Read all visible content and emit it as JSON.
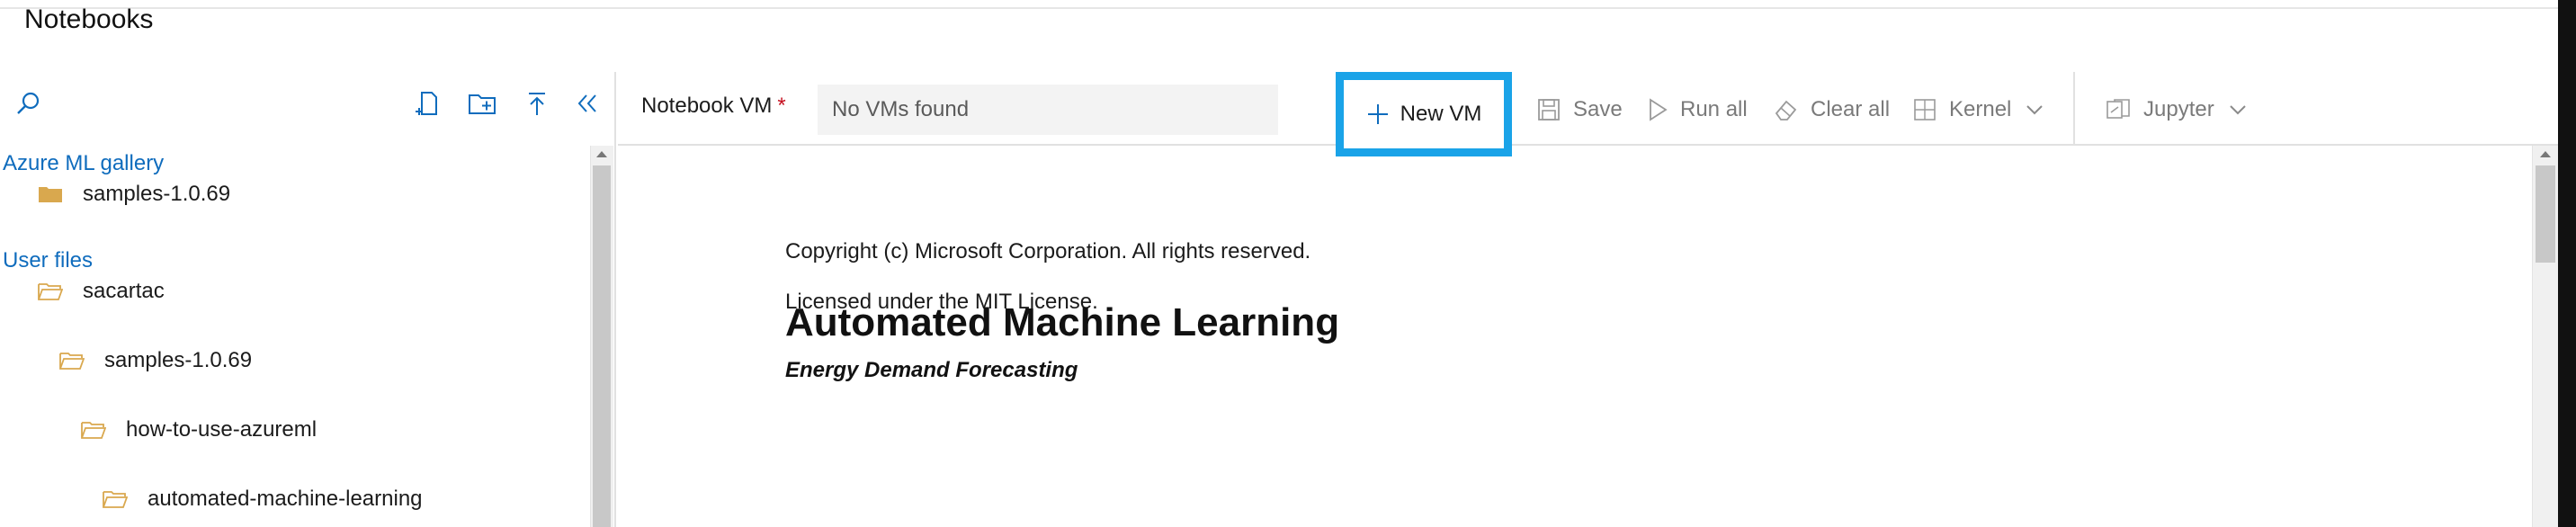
{
  "app": {
    "title": "Notebooks"
  },
  "sidebar": {
    "sections": [
      {
        "label": "Azure ML gallery"
      },
      {
        "label": "User files"
      }
    ],
    "items": [
      {
        "label": "samples-1.0.69",
        "icon": "folder-filled-icon"
      },
      {
        "label": "sacartac",
        "icon": "folder-open-icon"
      },
      {
        "label": "samples-1.0.69",
        "icon": "folder-open-icon"
      },
      {
        "label": "how-to-use-azureml",
        "icon": "folder-open-icon"
      },
      {
        "label": "automated-machine-learning",
        "icon": "folder-open-icon"
      }
    ],
    "toolbar_icons": [
      "search-icon",
      "new-file-icon",
      "new-folder-icon",
      "upload-icon",
      "collapse-icon"
    ]
  },
  "toolbar": {
    "vm_label": "Notebook VM",
    "vm_required": "*",
    "vm_placeholder": "No VMs found",
    "new_vm": "New VM",
    "save": "Save",
    "run_all": "Run all",
    "clear_all": "Clear all",
    "kernel": "Kernel",
    "jupyter": "Jupyter"
  },
  "notebook": {
    "copyright": "Copyright (c) Microsoft Corporation. All rights reserved.",
    "license": "Licensed under the MIT License.",
    "heading": "Automated Machine Learning",
    "subheading": "Energy Demand Forecasting"
  },
  "colors": {
    "link": "#0f6cbd",
    "highlight": "#1aa3e8",
    "required": "#c50f1f",
    "folder": "#d9a84e"
  }
}
